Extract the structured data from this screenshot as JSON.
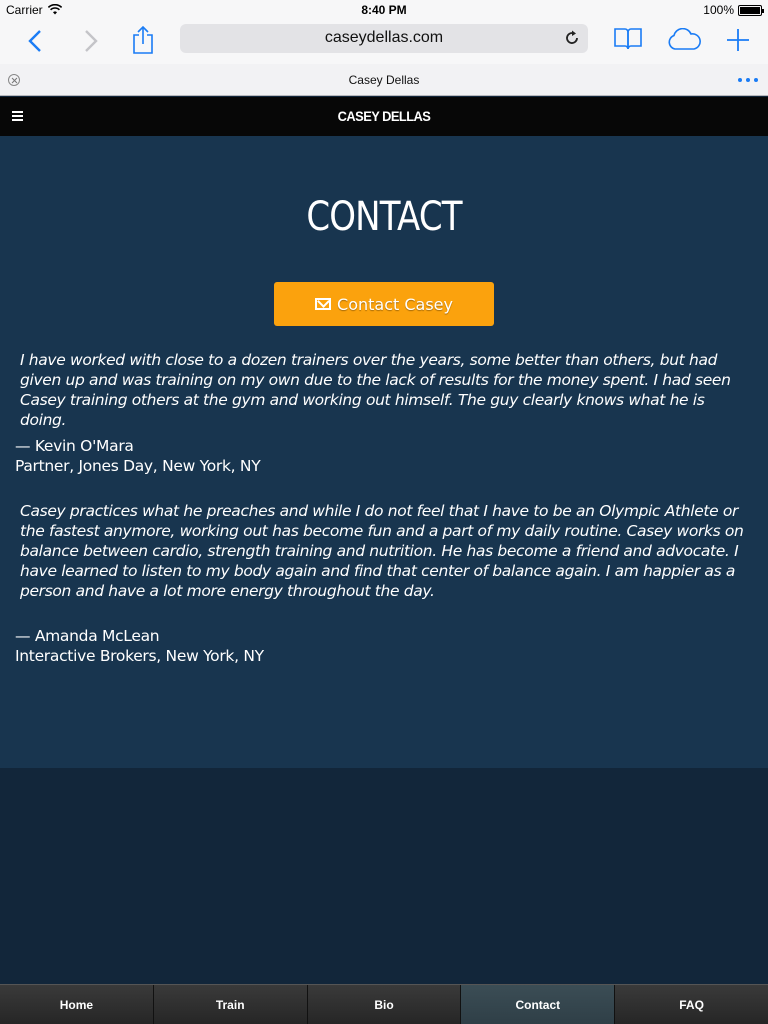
{
  "status_bar": {
    "carrier": "Carrier",
    "time": "8:40 PM",
    "battery": "100%"
  },
  "toolbar": {
    "url": "caseydellas.com",
    "icons": [
      "back-icon",
      "forward-icon",
      "share-icon",
      "reload-icon",
      "bookmarks-icon",
      "cloud-icon",
      "add-tab-icon"
    ]
  },
  "tab": {
    "title": "Casey Dellas"
  },
  "site": {
    "title": "CASEY DELLAS"
  },
  "main": {
    "heading": "CONTACT",
    "contact_button": "Contact Casey",
    "testimonials": [
      {
        "quote": "I have worked with close to a dozen trainers over the years, some better than others, but had given up and was training on my own due to the lack of results for the money spent. I had seen Casey training others at the gym and working out himself. The guy clearly knows what he is doing.",
        "author": "— Kevin O'Mara",
        "affiliation": "Partner, Jones Day, New York, NY"
      },
      {
        "quote": "Casey practices what he preaches and while I do not feel that I have to be an Olympic Athlete or the fastest anymore, working out has become fun and a part of my daily routine. Casey works on balance between cardio, strength training and nutrition. He has become a friend and advocate. I have learned to listen to my body again and find that center of balance again. I am happier as a person and have a lot more energy throughout the day.",
        "author": "— Amanda McLean",
        "affiliation": "Interactive Brokers, New York, NY"
      }
    ]
  },
  "bottom_nav": {
    "items": [
      {
        "label": "Home"
      },
      {
        "label": "Train"
      },
      {
        "label": "Bio"
      },
      {
        "label": "Contact",
        "active": true
      },
      {
        "label": "FAQ"
      }
    ]
  },
  "colors": {
    "accent_button": "#fba20d",
    "main_bg": "#18354f",
    "page_bg": "#12263a",
    "ios_blue": "#1a7cf5"
  }
}
